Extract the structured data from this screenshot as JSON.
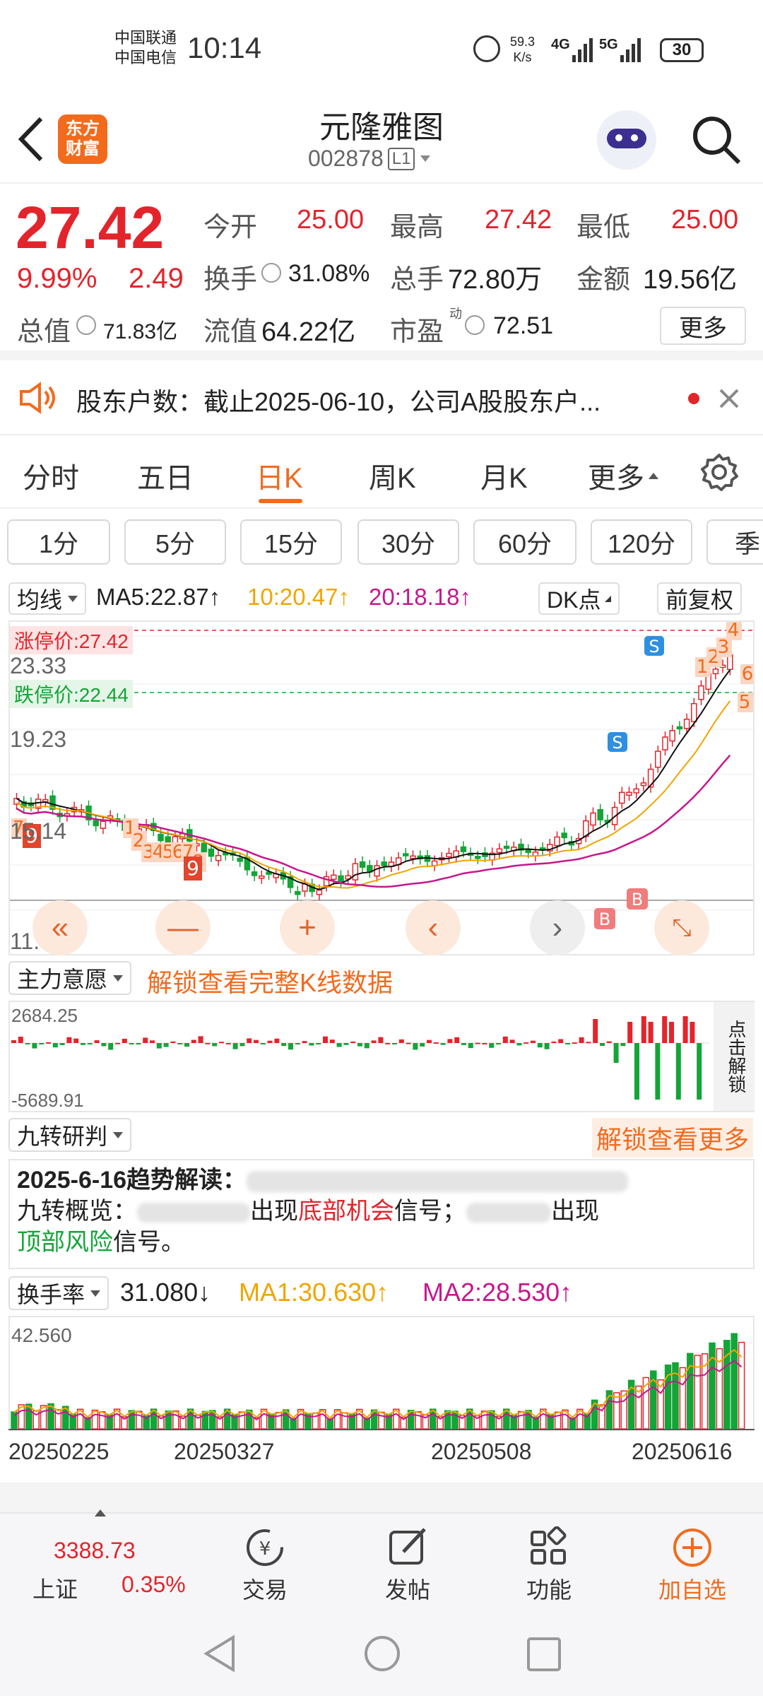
{
  "status": {
    "carrier1": "中国联通",
    "carrier2": "中国电信",
    "time": "10:14",
    "speed_value": "59.3",
    "speed_unit": "K/s",
    "net1": "4G",
    "net2": "5G",
    "battery": "30"
  },
  "nav": {
    "title": "元隆雅图",
    "code": "002878",
    "level": "L1",
    "logo_line1": "东方",
    "logo_line2": "财富"
  },
  "quote": {
    "price": "27.42",
    "pct": "9.99%",
    "change": "2.49",
    "open_label": "今开",
    "open": "25.00",
    "high_label": "最高",
    "high": "27.42",
    "low_label": "最低",
    "low": "25.00",
    "turnover_label": "换手",
    "turnover": "31.08%",
    "volume_label": "总手",
    "volume": "72.80万",
    "amount_label": "金额",
    "amount": "19.56亿",
    "mktcap_label": "总值",
    "mktcap": "71.83亿",
    "float_label": "流值",
    "float": "64.22亿",
    "pe_label": "市盈",
    "pe_sup": "动",
    "pe": "72.51",
    "more": "更多"
  },
  "notice": {
    "text": "股东户数：截止2025-06-10，公司A股股东户..."
  },
  "tabs": [
    "分时",
    "五日",
    "日K",
    "周K",
    "月K",
    "更多"
  ],
  "periods": [
    "1分",
    "5分",
    "15分",
    "30分",
    "60分",
    "120分",
    "季"
  ],
  "ma_bar": {
    "select": "均线",
    "ma5": "MA5:22.87↑",
    "ma10": "10:20.47↑",
    "ma20": "20:18.18↑",
    "dk": "DK点",
    "adjust": "前复权"
  },
  "kline": {
    "limit_up_label": "涨停价:27.42",
    "limit_down_label": "跌停价:22.44",
    "y_top": "23.33",
    "y_mid": "19.23",
    "y_low": "15.14",
    "y_min": "11.04"
  },
  "flow": {
    "select": "主力意愿",
    "unlock": "解锁查看完整K线数据",
    "ymax": "2684.25",
    "ymin": "-5689.91",
    "side": "点击解锁"
  },
  "nine": {
    "select": "九转研判",
    "unlock": "解锁查看更多",
    "title": "2025-6-16趋势解读：",
    "line1": "九转概览：",
    "mid1": "出现",
    "bottom": "底部机会",
    "sig": "信号；",
    "mid2": "出现",
    "top": "顶部风险",
    "sig2": "信号。"
  },
  "turn": {
    "select": "换手率",
    "value": "31.080↓",
    "ma1": "MA1:30.630↑",
    "ma2": "MA2:28.530↑",
    "ymax": "42.560"
  },
  "dates": [
    "20250225",
    "20250327",
    "20250508",
    "20250616"
  ],
  "bottom": {
    "index_value": "3388.73",
    "index_name": "上证",
    "index_pct": "0.35%",
    "trade": "交易",
    "post": "发帖",
    "func": "功能",
    "add": "加自选"
  },
  "colors": {
    "up": "#e3242b",
    "down": "#13a538",
    "accent": "#f26b1d",
    "ma5": "#111111",
    "ma10": "#f0a500",
    "ma20": "#c8168e"
  }
}
